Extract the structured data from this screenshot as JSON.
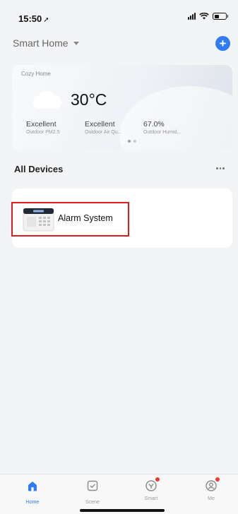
{
  "status_bar": {
    "time": "15:50",
    "location_arrow": "➚"
  },
  "header": {
    "home_selector_label": "Smart Home",
    "add_button_glyph": "+"
  },
  "weather": {
    "home_name": "Cozy Home",
    "temperature": "30°C",
    "metrics": [
      {
        "value": "Excellent",
        "label": "Outdoor PM2.5"
      },
      {
        "value": "Excellent",
        "label": "Outdoor Air Qu..."
      },
      {
        "value": "67.0%",
        "label": "Outdoor Humid..."
      }
    ]
  },
  "devices_section": {
    "title": "All Devices"
  },
  "devices": [
    {
      "name": "Alarm System",
      "icon": "alarm-panel-icon"
    }
  ],
  "tabs": [
    {
      "label": "Home",
      "icon": "home-icon",
      "active": true
    },
    {
      "label": "Scene",
      "icon": "scene-icon",
      "active": false
    },
    {
      "label": "Smart",
      "icon": "smart-icon",
      "active": false,
      "badge": true
    },
    {
      "label": "Me",
      "icon": "me-icon",
      "active": false,
      "badge": true
    }
  ],
  "colors": {
    "accent": "#2f7af5",
    "highlight_border": "#e01d1d",
    "badge": "#ee3b2f",
    "background": "#f3f4f6"
  }
}
